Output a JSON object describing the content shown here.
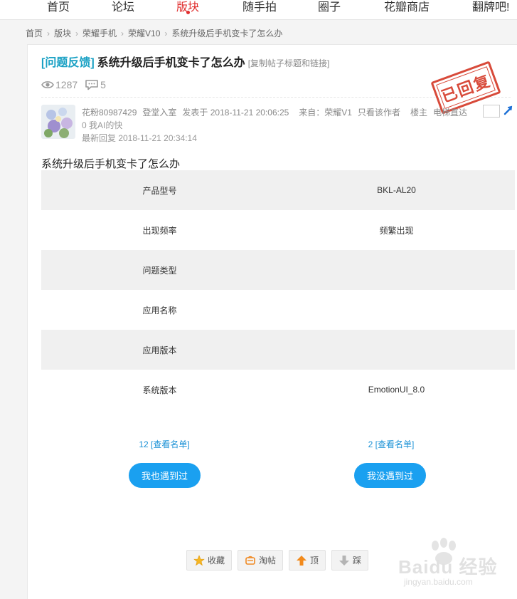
{
  "nav": {
    "items": [
      {
        "label": "首页"
      },
      {
        "label": "论坛"
      },
      {
        "label": "版块"
      },
      {
        "label": "随手拍"
      },
      {
        "label": "圈子"
      },
      {
        "label": "花瓣商店"
      },
      {
        "label": "翻牌吧!"
      }
    ],
    "active_index": 2,
    "active_color": "#e02e2e"
  },
  "breadcrumb": [
    "首页",
    "版块",
    "荣耀手机",
    "荣耀V10",
    "系统升级后手机变卡了怎么办"
  ],
  "post": {
    "tag": "[问题反馈]",
    "title": "系统升级后手机变卡了怎么办",
    "copy_link": "[复制帖子标题和链接]",
    "views": "1287",
    "replies": "5",
    "stamp": "已回复",
    "author": {
      "name": "花粉80987429",
      "checkin": "登堂入室",
      "posted_at": "发表于 2018-11-21 20:06:25",
      "source": "来自：荣耀V1",
      "only_author": "只看该作者",
      "floor_owner": "楼主",
      "elevator": "电梯直达",
      "sub_line": "0 我AI的快",
      "last_reply": "最新回复 2018-11-21 20:34:14"
    },
    "heading": "系统升级后手机变卡了怎么办",
    "table": [
      {
        "label": "产品型号",
        "value": "BKL-AL20"
      },
      {
        "label": "出现频率",
        "value": "频繁出现"
      },
      {
        "label": "问题类型",
        "value": ""
      },
      {
        "label": "应用名称",
        "value": ""
      },
      {
        "label": "应用版本",
        "value": ""
      },
      {
        "label": "系统版本",
        "value": "EmotionUI_8.0"
      }
    ],
    "vote": {
      "met_count": "12 [查看名单]",
      "not_met_count": "2 [查看名单]",
      "met_label": "我也遇到过",
      "not_met_label": "我没遇到过"
    },
    "actions": {
      "favorite": "收藏",
      "taotie": "淘帖",
      "up": "顶",
      "down": "踩"
    }
  },
  "watermark": {
    "brand": "Baidu 经验",
    "site": "jingyan.baidu.com"
  },
  "colors": {
    "accent_blue": "#1aa0f0",
    "tag_teal": "#1aa1c4",
    "stamp_red": "#d84a3a"
  }
}
